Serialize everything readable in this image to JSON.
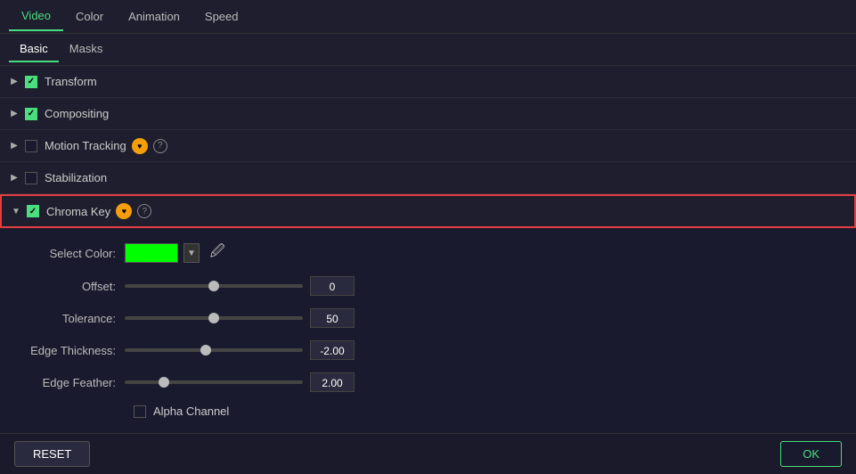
{
  "tabs": {
    "top": [
      {
        "label": "Video",
        "active": true
      },
      {
        "label": "Color",
        "active": false
      },
      {
        "label": "Animation",
        "active": false
      },
      {
        "label": "Speed",
        "active": false
      }
    ],
    "secondary": [
      {
        "label": "Basic",
        "active": true
      },
      {
        "label": "Masks",
        "active": false
      }
    ]
  },
  "sections": [
    {
      "id": "transform",
      "label": "Transform",
      "checked": true,
      "expanded": false,
      "hasPro": false,
      "hasHelp": false
    },
    {
      "id": "compositing",
      "label": "Compositing",
      "checked": true,
      "expanded": false,
      "hasPro": false,
      "hasHelp": false
    },
    {
      "id": "motion-tracking",
      "label": "Motion Tracking",
      "checked": false,
      "expanded": false,
      "hasPro": true,
      "hasHelp": true
    },
    {
      "id": "stabilization",
      "label": "Stabilization",
      "checked": false,
      "expanded": false,
      "hasPro": false,
      "hasHelp": false
    },
    {
      "id": "chroma-key",
      "label": "Chroma Key",
      "checked": true,
      "expanded": true,
      "hasPro": true,
      "hasHelp": true
    }
  ],
  "chromaKey": {
    "selectColorLabel": "Select Color:",
    "color": "#00ff00",
    "offsetLabel": "Offset:",
    "offsetValue": "0",
    "offsetPercent": 50,
    "toleranceLabel": "Tolerance:",
    "toleranceValue": "50",
    "tolerancePercent": 50,
    "edgeThicknessLabel": "Edge Thickness:",
    "edgeThicknessValue": "-2.00",
    "edgeThicknessPercent": 45,
    "edgeFeatherLabel": "Edge Feather:",
    "edgeFeatherValue": "2.00",
    "edgeFeatherPercent": 20,
    "alphaChannelLabel": "Alpha Channel"
  },
  "buttons": {
    "reset": "RESET",
    "ok": "OK"
  },
  "icons": {
    "eyedropper": "✏",
    "proLabel": "♥",
    "helpLabel": "?"
  }
}
